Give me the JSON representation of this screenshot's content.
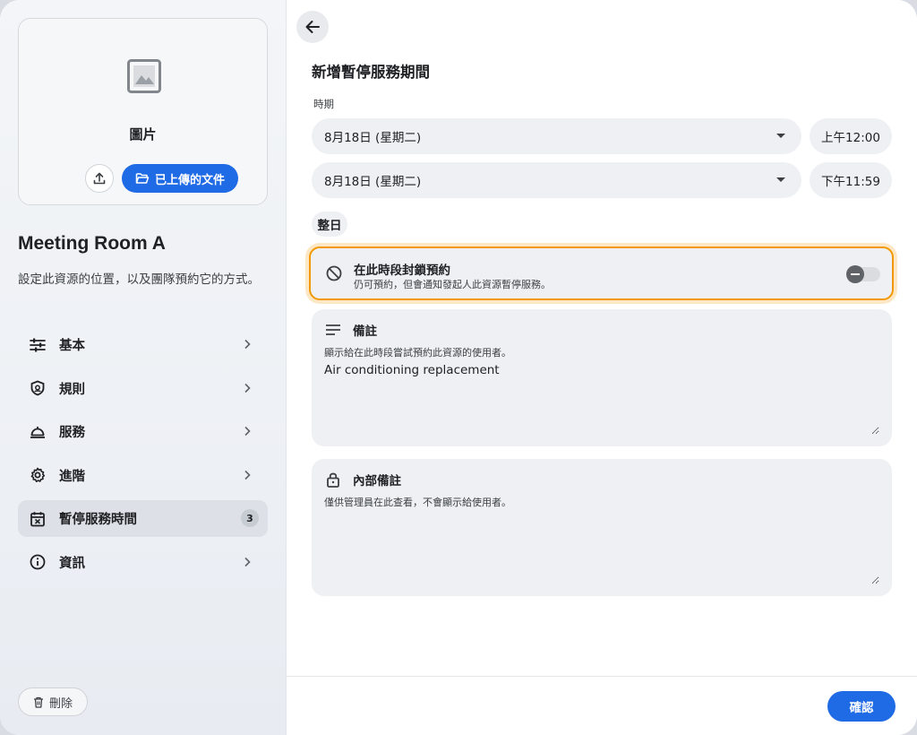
{
  "media": {
    "label": "圖片",
    "files_button": "已上傳的文件"
  },
  "resource": {
    "title": "Meeting Room A",
    "description": "設定此資源的位置，以及團隊預約它的方式。"
  },
  "nav": {
    "items": [
      {
        "label": "基本",
        "icon": "sliders-icon"
      },
      {
        "label": "規則",
        "icon": "shield-icon"
      },
      {
        "label": "服務",
        "icon": "service-bell-icon"
      },
      {
        "label": "進階",
        "icon": "gear-icon"
      },
      {
        "label": "暫停服務時間",
        "icon": "calendar-x-icon",
        "badge": "3",
        "active": true
      },
      {
        "label": "資訊",
        "icon": "info-icon"
      }
    ]
  },
  "delete_label": "刪除",
  "form": {
    "title": "新增暫停服務期間",
    "period_label": "時期",
    "start_date": "8月18日 (星期二)",
    "start_time": "上午12:00",
    "end_date": "8月18日 (星期二)",
    "end_time": "下午11:59",
    "all_day": "整日",
    "block": {
      "title": "在此時段封鎖預約",
      "subtitle": "仍可預約，但會通知發起人此資源暫停服務。",
      "enabled": false
    },
    "note": {
      "title": "備註",
      "subtitle": "顯示給在此時段嘗試預約此資源的使用者。",
      "value": "Air conditioning replacement"
    },
    "internal_note": {
      "title": "內部備註",
      "subtitle": "僅供管理員在此查看，不會顯示給使用者。",
      "value": ""
    }
  },
  "confirm_label": "確認",
  "colors": {
    "accent": "#1f6ae5",
    "highlight": "#f29900"
  }
}
